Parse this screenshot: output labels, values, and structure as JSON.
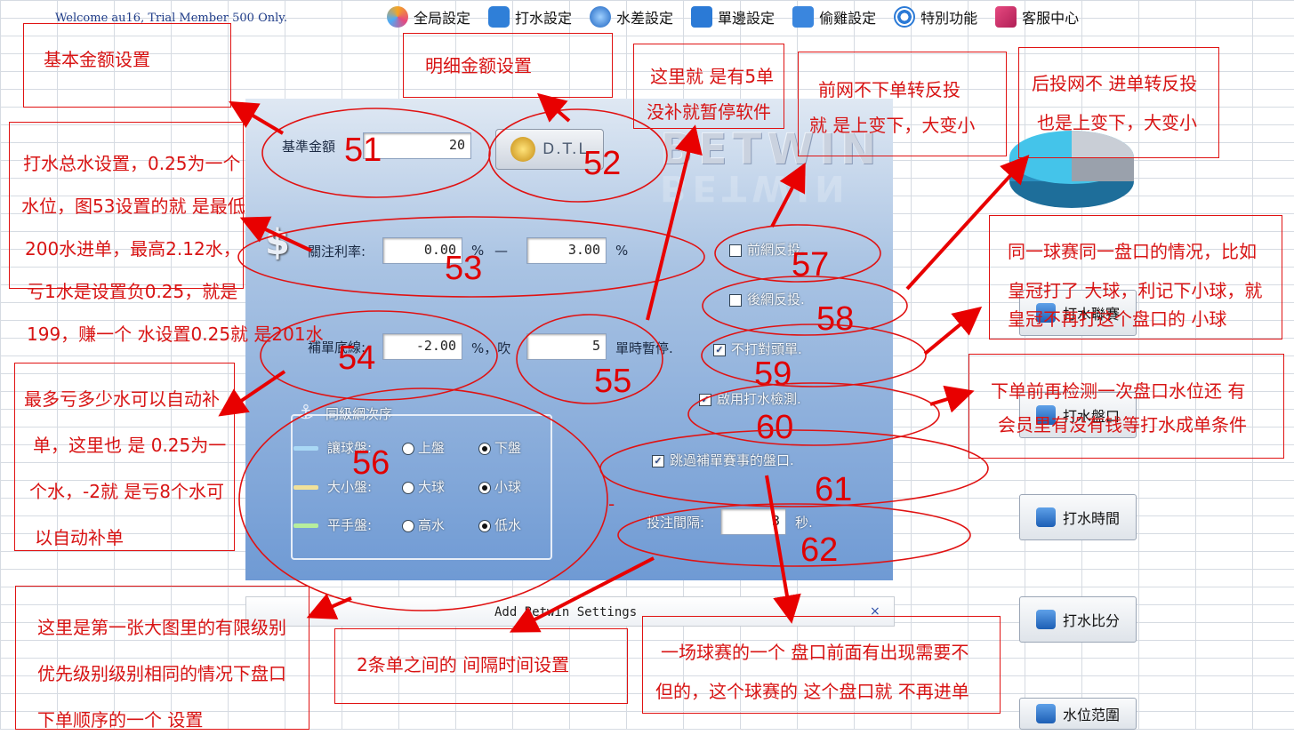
{
  "welcome": "Welcome au16, Trial Member 500 Only.",
  "menu": [
    {
      "label": "全局設定",
      "icon": "wand-icon"
    },
    {
      "label": "打水設定",
      "icon": "search-icon"
    },
    {
      "label": "水差設定",
      "icon": "globe-icon"
    },
    {
      "label": "單邊設定",
      "icon": "download-icon"
    },
    {
      "label": "偷雞設定",
      "icon": "plus-square-icon"
    },
    {
      "label": "特別功能",
      "icon": "target-icon"
    },
    {
      "label": "客服中心",
      "icon": "book-icon"
    }
  ],
  "settings": {
    "base_amount_label": "基準金額",
    "base_amount_value": "20",
    "dtl_label": "D.T.L",
    "brand": "BETWIN",
    "rate_label": "關注利率:",
    "rate_min": "0.00",
    "rate_pct1": "%",
    "rate_dash": "—",
    "rate_max": "3.00",
    "rate_pct2": "%",
    "stop_label": "補單底線:",
    "stop_value": "-2.00",
    "stop_mid": "%，吹",
    "stop_count": "5",
    "stop_suffix": "單時暫停.",
    "cb_front": "前網反投.",
    "cb_back": "後網反投.",
    "cb_nohead": "不打對頭單.",
    "cb_detect": "啟用打水檢測.",
    "cb_skip": "跳過補單賽事的盤口.",
    "group_title": "同級網次序",
    "rows": [
      {
        "label": "讓球盤:",
        "a": "上盤",
        "b": "下盤",
        "color": "#a9d8f5"
      },
      {
        "label": "大小盤:",
        "a": "大球",
        "b": "小球",
        "color": "#f1e19a"
      },
      {
        "label": "平手盤:",
        "a": "高水",
        "b": "低水",
        "color": "#b7ee9c"
      }
    ],
    "interval_label": "投注間隔:",
    "interval_value": "3",
    "interval_unit": "秒.",
    "footer": "Add Betwin Settings",
    "footer_close": "×"
  },
  "side_buttons": [
    {
      "label": "打水聯賽",
      "icon": "chevron-right-icon"
    },
    {
      "label": "打水盤口",
      "icon": "h-icon"
    },
    {
      "label": "打水時間",
      "icon": "magnifier-icon"
    },
    {
      "label": "打水比分",
      "icon": "paperclip-icon"
    },
    {
      "label": "水位范圍",
      "icon": "chart-icon"
    }
  ],
  "annotations": {
    "a1": "基本金额设置",
    "a2": "明细金额设置",
    "a3l1": "这里就 是有5单",
    "a3l2": "没补就暂停软件",
    "a4l1": "前网不下单转反投",
    "a4l2": "就 是上变下，大变小",
    "a5l1": "后投网不 进单转反投",
    "a5l2": "也是上变下，大变小",
    "a6l1": "打水总水设置，0.25为一个",
    "a6l2": "水位，图53设置的就 是最低",
    "a6l3": "200水进单，最高2.12水，",
    "a6l4": "亏1水是设置负0.25，就是",
    "a6l5": "199，赚一个 水设置0.25就 是201水",
    "a7l1": "同一球赛同一盘口的情况，比如",
    "a7l2": "皇冠打了 大球，利记下小球，就",
    "a7l3": "皇冠不再打这个盘口的 小球",
    "a8l1": "最多亏多少水可以自动补",
    "a8l2": "单，这里也 是 0.25为一",
    "a8l3": "个水，-2就 是亏8个水可",
    "a8l4": "以自动补单",
    "a9l1": "下单前再检测一次盘口水位还 有",
    "a9l2": "会员里有没有钱等打水成单条件",
    "a10l1": "这里是第一张大图里的有限级别",
    "a10l2": "优先级别级别相同的情况下盘口",
    "a10l3": "下单顺序的一个 设置",
    "a11": "2条单之间的 间隔时间设置",
    "a12l1": "一场球赛的一个 盘口前面有出现需要不",
    "a12l2": "但的，这个球赛的 这个盘口就 不再进单",
    "dash": "-"
  },
  "numbers": [
    "51",
    "52",
    "53",
    "54",
    "55",
    "56",
    "57",
    "58",
    "59",
    "60",
    "61",
    "62"
  ]
}
